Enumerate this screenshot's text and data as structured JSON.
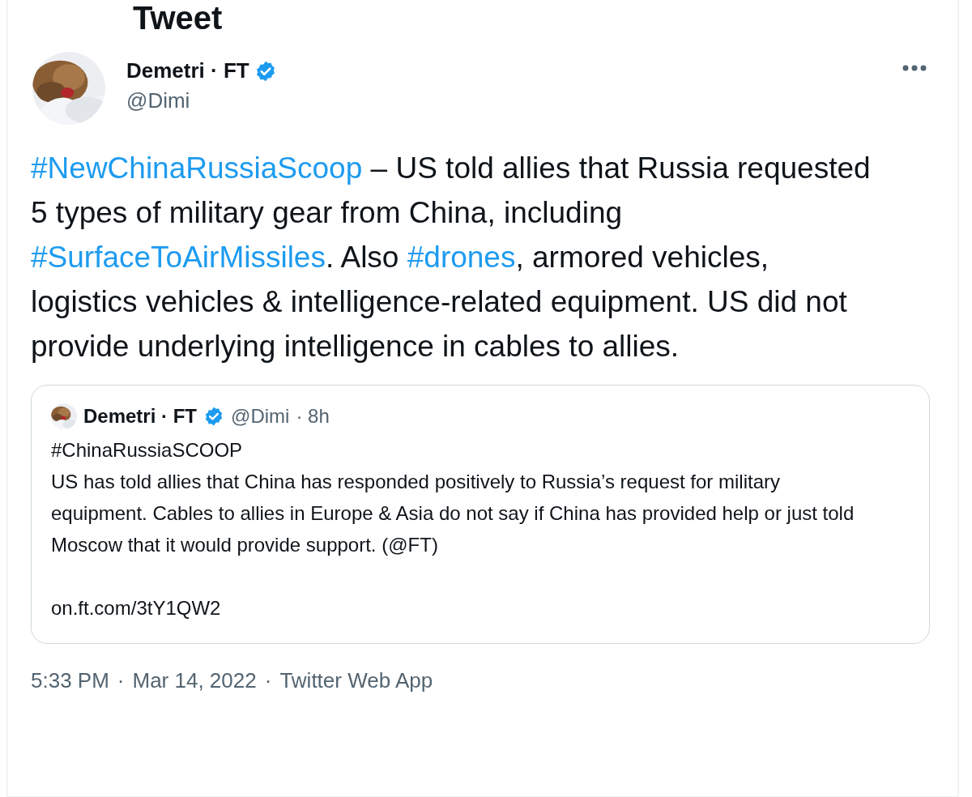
{
  "header": {
    "title": "Tweet"
  },
  "author": {
    "name": "Demetri · FT",
    "verified": true,
    "handle": "@Dimi"
  },
  "tweet_text": [
    {
      "kind": "hashtag",
      "text": "#NewChinaRussiaScoop"
    },
    {
      "kind": "text",
      "text": " – US told allies that Russia requested 5 types of military gear from China, including "
    },
    {
      "kind": "hashtag",
      "text": "#SurfaceToAirMissiles"
    },
    {
      "kind": "text",
      "text": ". Also "
    },
    {
      "kind": "hashtag",
      "text": "#drones"
    },
    {
      "kind": "text",
      "text": ", armored vehicles, logistics vehicles & intelligence-related equipment. US did not provide underlying intelligence in cables to allies."
    }
  ],
  "quoted_tweet": {
    "name": "Demetri · FT",
    "verified": true,
    "handle": "@Dimi",
    "age": "· 8h",
    "lines": [
      {
        "kind": "heading",
        "text": "#ChinaRussiaSCOOP"
      },
      {
        "kind": "body",
        "text": "US has told allies that China has responded positively to Russia’s request for military equipment. Cables to allies in Europe & Asia do not say if China has provided help or just told Moscow that it would provide support. (@FT)"
      },
      {
        "kind": "link",
        "text": "on.ft.com/3tY1QW2"
      }
    ]
  },
  "meta": [
    "5:33 PM",
    "·",
    "Mar 14, 2022",
    "·",
    "Twitter Web App"
  ]
}
